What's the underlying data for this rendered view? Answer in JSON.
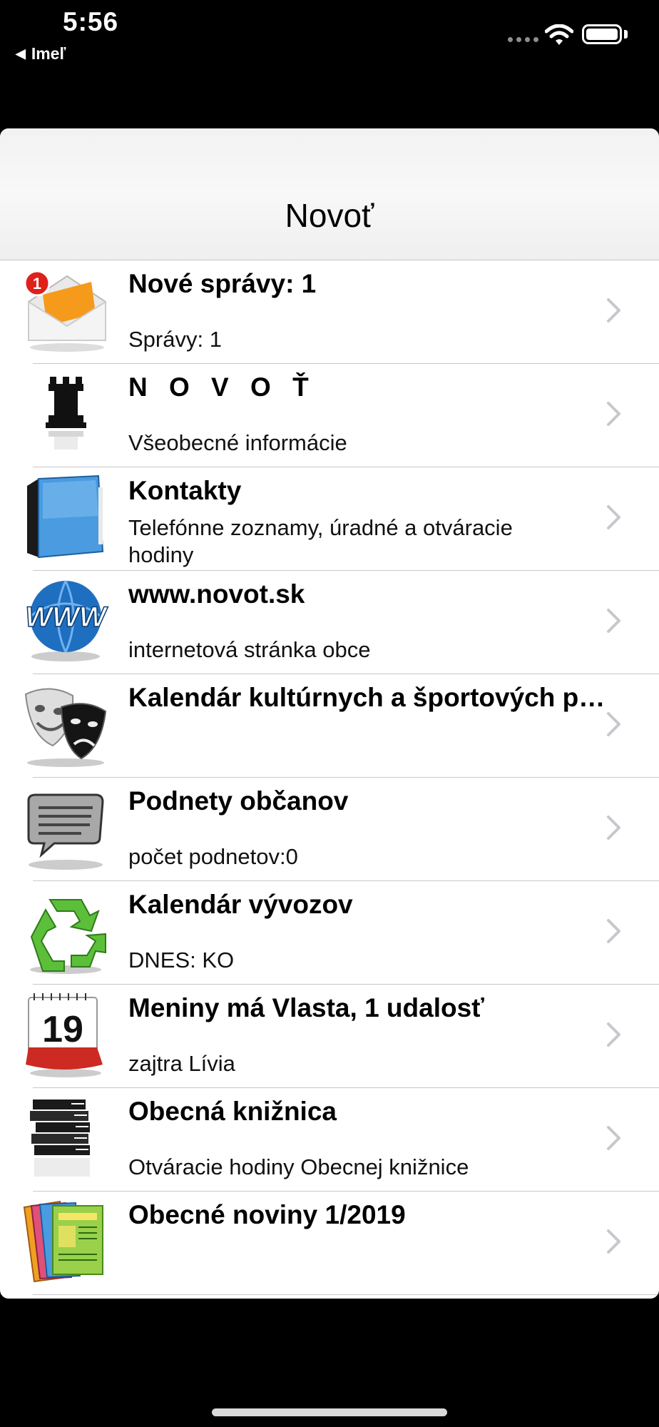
{
  "status": {
    "time": "5:56",
    "back_app": "Imeľ"
  },
  "nav": {
    "title": "Novoť"
  },
  "items": [
    {
      "title": "Nové správy: 1",
      "subtitle": "Správy: 1",
      "badge": "1",
      "icon": "mail-icon"
    },
    {
      "title": "N O V O Ť",
      "subtitle": "Všeobecné informácie",
      "icon": "chess-rook-icon"
    },
    {
      "title": "Kontakty",
      "subtitle": "Telefónne zoznamy, úradné a otváracie hodiny",
      "icon": "address-book-icon"
    },
    {
      "title": "www.novot.sk",
      "subtitle": "internetová stránka obce",
      "icon": "www-globe-icon"
    },
    {
      "title": "Kalendár kultúrnych a športových podujatí",
      "subtitle": "",
      "icon": "theater-masks-icon"
    },
    {
      "title": "Podnety občanov",
      "subtitle": "počet podnetov:0",
      "icon": "speech-bubble-icon"
    },
    {
      "title": "Kalendár vývozov",
      "subtitle": "DNES: KO",
      "icon": "recycle-icon"
    },
    {
      "title": "Meniny má Vlasta, 1 udalosť",
      "subtitle": "zajtra Lívia",
      "calendar_day": "19",
      "icon": "calendar-icon"
    },
    {
      "title": "Obecná knižnica",
      "subtitle": "Otváracie hodiny Obecnej knižnice",
      "icon": "books-icon"
    },
    {
      "title": "Obecné noviny 1/2019",
      "subtitle": "",
      "icon": "newspaper-icon"
    }
  ],
  "colors": {
    "badge": "#e0201b",
    "chevron": "#c7c7cc",
    "separator": "#c8c7cc"
  }
}
